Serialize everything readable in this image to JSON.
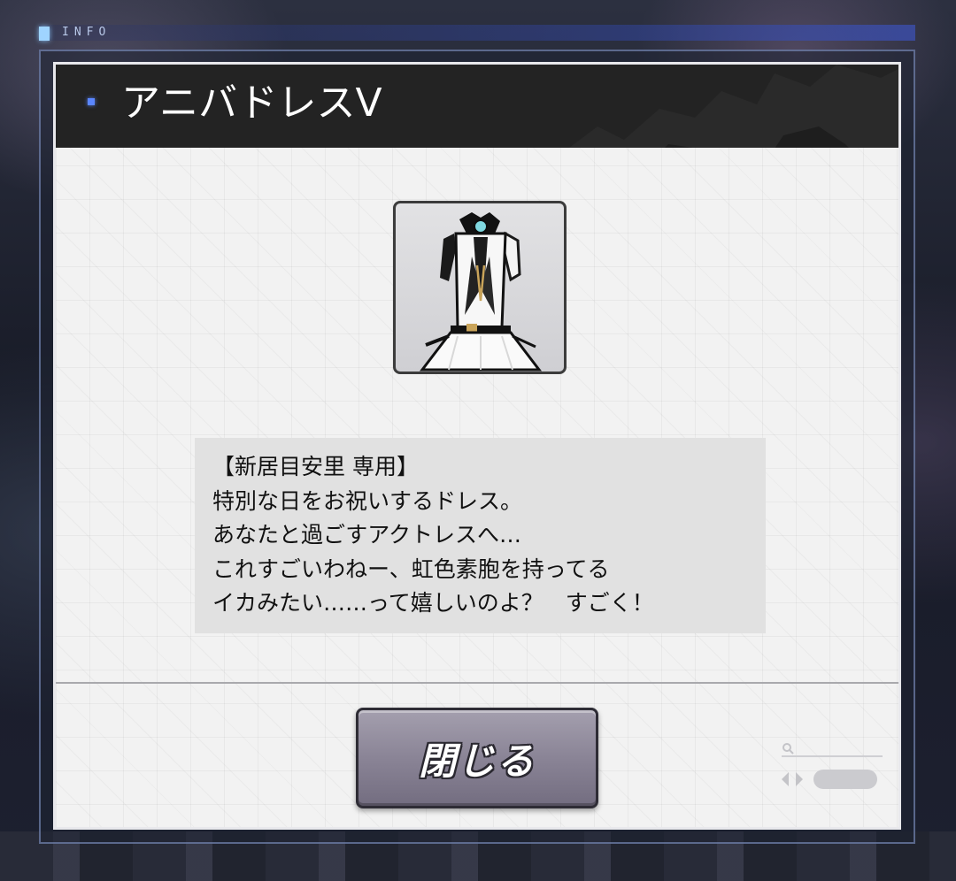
{
  "header": {
    "info_label": "INFO"
  },
  "dialog": {
    "title": "アニバドレスV",
    "item_icon": "dress-icon",
    "description": [
      "【新居目安里 専用】",
      "特別な日をお祝いするドレス。",
      "あなたと過ごすアクトレスへ…",
      "これすごいわねー、虹色素胞を持ってる",
      "イカみたい……って嬉しいのよ？　すごく！"
    ],
    "close_label": "閉じる"
  },
  "colors": {
    "title_bar": "#232323",
    "title_bullet": "#5a86ff",
    "panel_bg": "#f2f2f2",
    "description_bg": "#e1e1e1",
    "close_button": "#8a8496",
    "info_accent": "#9fd4ff"
  }
}
